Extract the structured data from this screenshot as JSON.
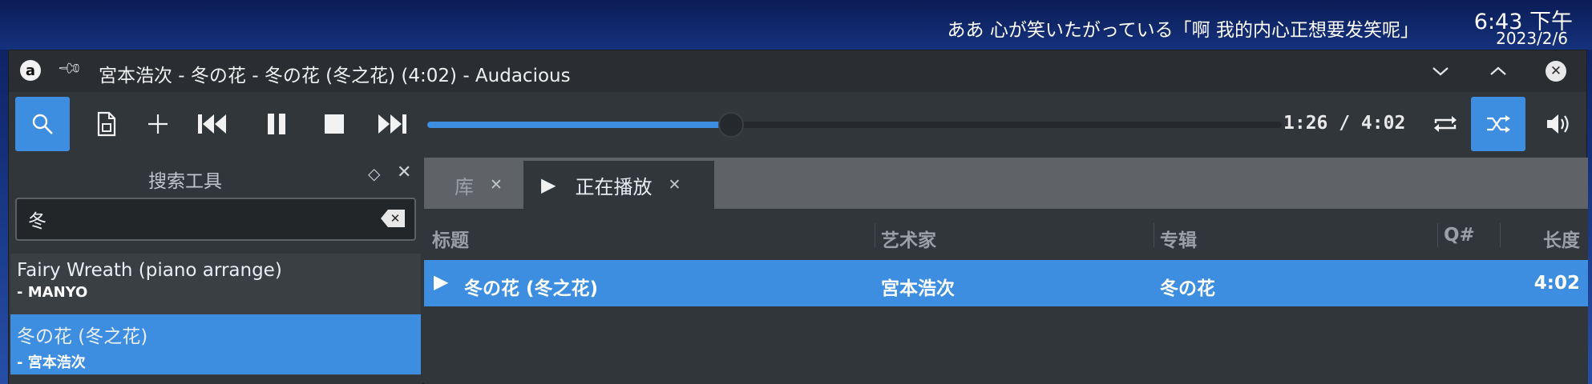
{
  "system_panel": {
    "now_playing_text": "ああ 心が笑いたがっている「啊 我的内心正想要发笑呢」",
    "clock_time": "6:43 下午",
    "clock_date": "2023/2/6"
  },
  "window": {
    "title": "宮本浩次 - 冬の花 - 冬の花 (冬之花) (4:02) - Audacious",
    "app_logo": "a"
  },
  "toolbar": {
    "search_active": true,
    "shuffle_active": true,
    "time_readout": "1:26 / 4:02",
    "progress_fraction": 0.3554
  },
  "sidebar": {
    "title": "搜索工具",
    "search_value": "冬",
    "results": [
      {
        "title": "Fairy Wreath (piano arrange)",
        "artist": "- MANYO",
        "selected": false
      },
      {
        "title": "冬の花 (冬之花)",
        "artist": "- 宮本浩次",
        "selected": true
      }
    ]
  },
  "tabs": [
    {
      "label": "库",
      "active": false
    },
    {
      "label": "正在播放",
      "active": true
    }
  ],
  "playlist": {
    "columns": [
      "标题",
      "艺术家",
      "专辑",
      "Q#",
      "长度"
    ],
    "rows": [
      {
        "title": "冬の花 (冬之花)",
        "artist": "宮本浩次",
        "album": "冬の花",
        "queue": "",
        "length": "4:02",
        "playing": true
      }
    ]
  },
  "colors": {
    "accent": "#3d8ee0",
    "window_bg": "#31363b",
    "titlebar_bg": "#2a2e32",
    "tabbar_bg": "#5f6368"
  },
  "icons": {
    "search": "search-icon",
    "open": "open-file-icon",
    "add": "add-icon",
    "prev": "skip-back-icon",
    "pause": "pause-icon",
    "stop": "stop-icon",
    "next": "skip-forward-icon",
    "repeat": "repeat-icon",
    "shuffle": "shuffle-icon",
    "volume": "volume-icon"
  }
}
